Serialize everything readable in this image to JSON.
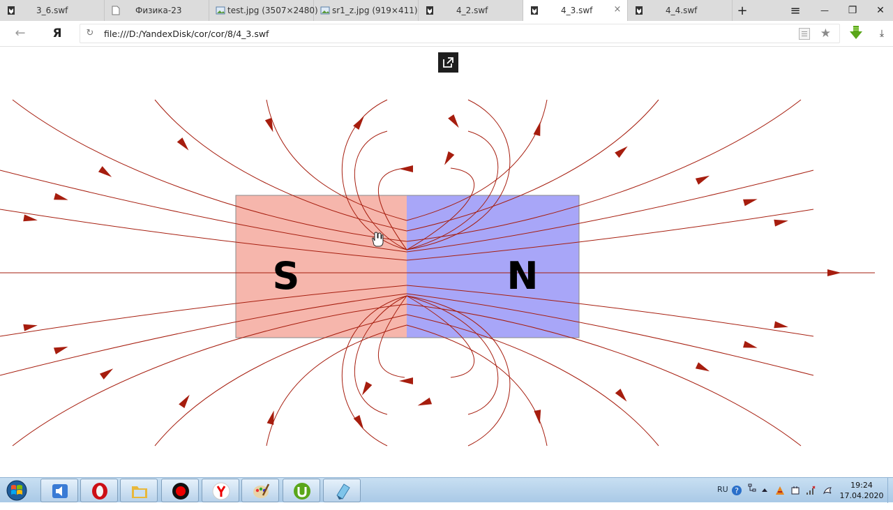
{
  "tabs": [
    {
      "label": "3_6.swf",
      "icon": "swf-file-icon"
    },
    {
      "label": "Физика-23",
      "icon": "blank-page-icon"
    },
    {
      "label": "test.jpg (3507×2480)",
      "icon": "image-file-icon"
    },
    {
      "label": "sr1_z.jpg (919×411)",
      "icon": "image-file-icon"
    },
    {
      "label": "4_2.swf",
      "icon": "swf-file-icon"
    },
    {
      "label": "4_3.swf",
      "icon": "swf-file-icon",
      "active": true
    },
    {
      "label": "4_4.swf",
      "icon": "swf-file-icon"
    }
  ],
  "tab_close_glyph": "×",
  "new_tab_glyph": "+",
  "window_controls": {
    "menu": "≡",
    "minimize": "—",
    "restore": "❐",
    "close": "✕"
  },
  "address": {
    "back_glyph": "←",
    "browser_logo": "Я",
    "reload_glyph": "↻",
    "url": "file:///D:/YandexDisk/cor/cor/8/4_3.swf",
    "bookmark_glyph": "★",
    "download_glyph": "⤓"
  },
  "magnet": {
    "left_pole": "S",
    "right_pole": "N",
    "left_color": "#f6b6ac",
    "right_color": "#a8a6f8",
    "field_line_color": "#a61d0e"
  },
  "taskbar": {
    "apps": [
      "speaker-icon",
      "opera-icon",
      "explorer-folder-icon",
      "recorder-icon",
      "yandex-browser-icon",
      "paint-icon",
      "utorrent-icon",
      "notepad-icon"
    ],
    "language": "RU",
    "time": "19:24",
    "date": "17.04.2020"
  },
  "colors": {
    "tab_strip": "#dcdcdc",
    "taskbar": "#b8d4ec",
    "accent_green": "#5aa61a"
  }
}
